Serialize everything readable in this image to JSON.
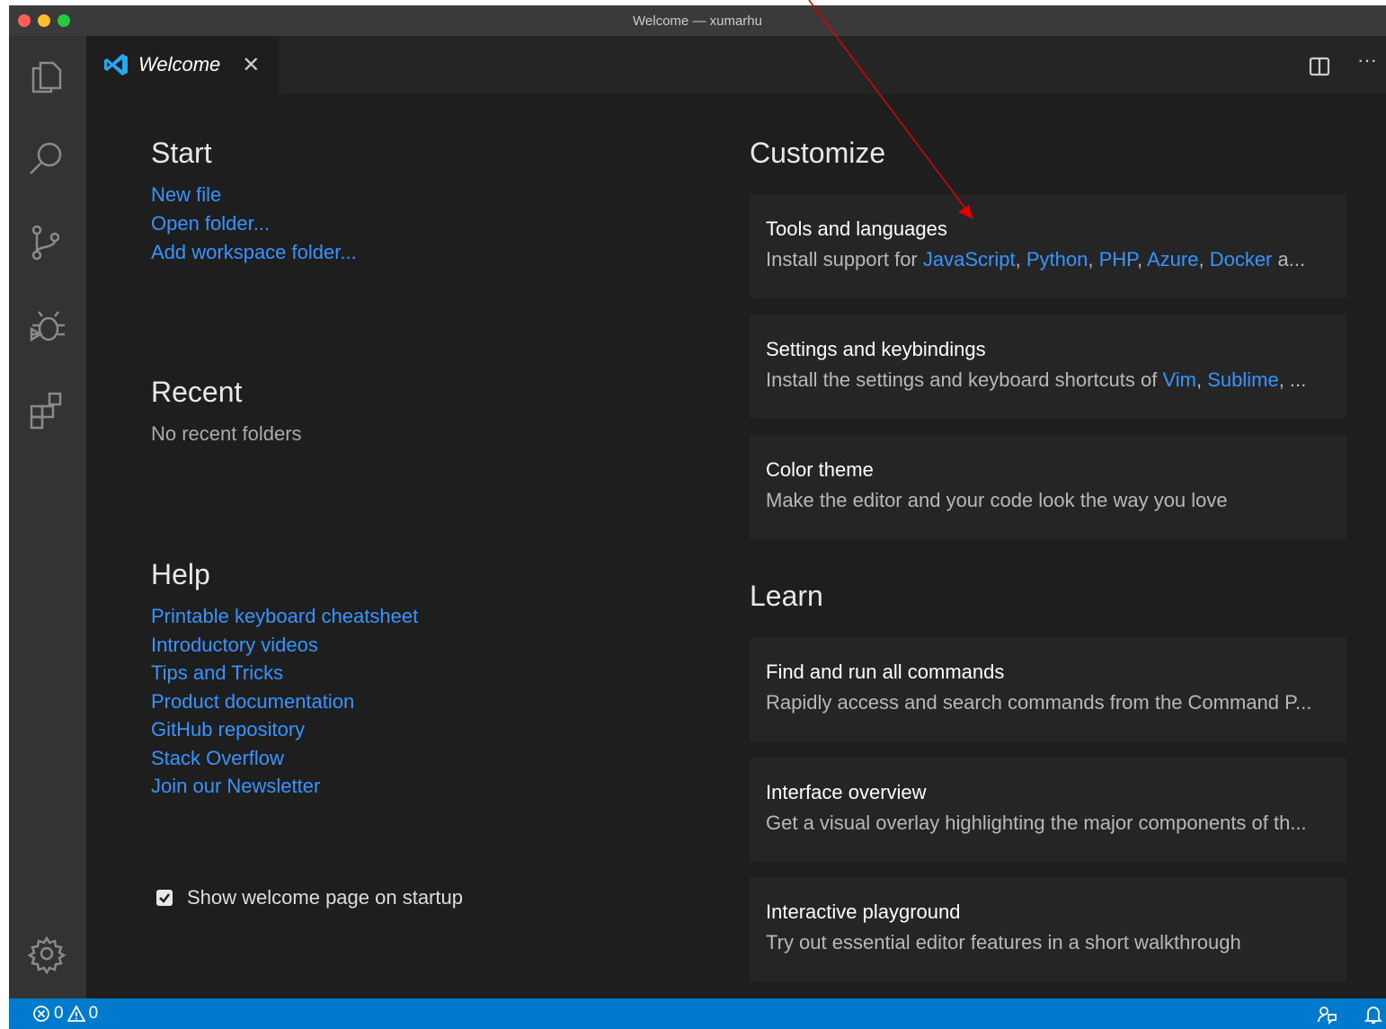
{
  "window": {
    "title": "Welcome — xumarhu"
  },
  "tab": {
    "title": "Welcome",
    "close": "✕"
  },
  "toolbar": {
    "more": "···"
  },
  "start": {
    "heading": "Start",
    "links": [
      "New file",
      "Open folder...",
      "Add workspace folder..."
    ]
  },
  "recent": {
    "heading": "Recent",
    "empty": "No recent folders"
  },
  "help": {
    "heading": "Help",
    "links": [
      "Printable keyboard cheatsheet",
      "Introductory videos",
      "Tips and Tricks",
      "Product documentation",
      "GitHub repository",
      "Stack Overflow",
      "Join our Newsletter"
    ]
  },
  "customize": {
    "heading": "Customize",
    "cards": [
      {
        "title": "Tools and languages",
        "desc_prefix": "Install support for ",
        "links": [
          "JavaScript",
          "Python",
          "PHP",
          "Azure",
          "Docker"
        ],
        "sep": ", ",
        "suffix": " a..."
      },
      {
        "title": "Settings and keybindings",
        "desc_prefix": "Install the settings and keyboard shortcuts of ",
        "links": [
          "Vim",
          "Sublime"
        ],
        "sep": ", ",
        "suffix": ", ..."
      },
      {
        "title": "Color theme",
        "desc": "Make the editor and your code look the way you love"
      }
    ]
  },
  "learn": {
    "heading": "Learn",
    "cards": [
      {
        "title": "Find and run all commands",
        "desc": "Rapidly access and search commands from the Command P..."
      },
      {
        "title": "Interface overview",
        "desc": "Get a visual overlay highlighting the major components of th..."
      },
      {
        "title": "Interactive playground",
        "desc": "Try out essential editor features in a short walkthrough"
      }
    ]
  },
  "startup": {
    "label": "Show welcome page on startup",
    "checked": true
  },
  "statusbar": {
    "errors": "0",
    "warnings": "0"
  },
  "colors": {
    "accent": "#007acc",
    "link": "#3794ff",
    "annotation": "#e00000"
  },
  "icons": [
    "files-icon",
    "search-icon",
    "source-control-icon",
    "debug-icon",
    "extensions-icon",
    "gear-icon",
    "vscode-logo-icon",
    "split-editor-icon",
    "error-icon",
    "warning-icon",
    "feedback-icon",
    "bell-icon"
  ]
}
